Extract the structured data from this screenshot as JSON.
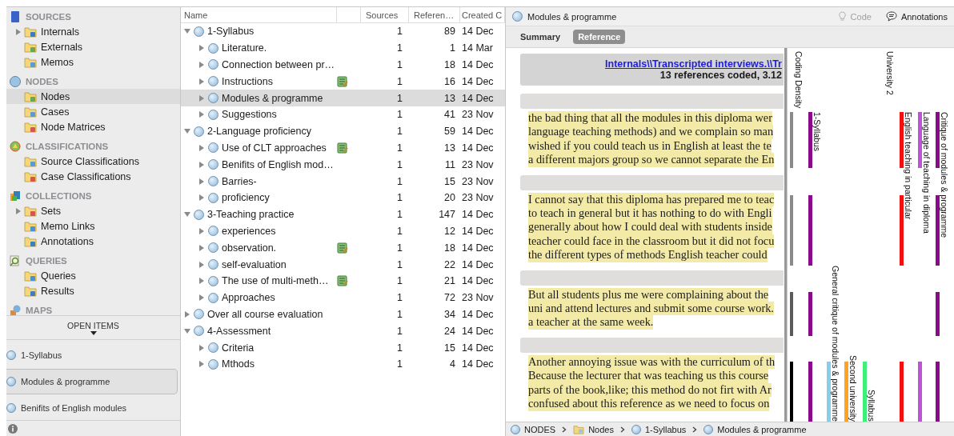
{
  "sidebar": {
    "sections": [
      {
        "title": "SOURCES",
        "items": [
          {
            "label": "Internals",
            "has_children": true,
            "selected": false
          },
          {
            "label": "Externals",
            "has_children": false,
            "selected": false
          },
          {
            "label": "Memos",
            "has_children": false,
            "selected": false
          }
        ]
      },
      {
        "title": "NODES",
        "items": [
          {
            "label": "Nodes",
            "has_children": false,
            "selected": true
          },
          {
            "label": "Cases",
            "has_children": false,
            "selected": false
          },
          {
            "label": "Node Matrices",
            "has_children": false,
            "selected": false
          }
        ]
      },
      {
        "title": "CLASSIFICATIONS",
        "items": [
          {
            "label": "Source Classifications",
            "has_children": false,
            "selected": false
          },
          {
            "label": "Case Classifications",
            "has_children": false,
            "selected": false
          }
        ]
      },
      {
        "title": "COLLECTIONS",
        "items": [
          {
            "label": "Sets",
            "has_children": true,
            "selected": false
          },
          {
            "label": "Memo Links",
            "has_children": false,
            "selected": false
          },
          {
            "label": "Annotations",
            "has_children": false,
            "selected": false
          }
        ]
      },
      {
        "title": "QUERIES",
        "items": [
          {
            "label": "Queries",
            "has_children": false,
            "selected": false
          },
          {
            "label": "Results",
            "has_children": false,
            "selected": false
          }
        ]
      },
      {
        "title": "MAPS"
      }
    ]
  },
  "open_items": {
    "title": "OPEN ITEMS",
    "items": [
      {
        "label": "1-Syllabus",
        "selected": false
      },
      {
        "label": "Modules & programme",
        "selected": true
      },
      {
        "label": "Benifits of English modules",
        "selected": false
      }
    ]
  },
  "tree": {
    "columns": [
      "Name",
      "Sources",
      "Referen…",
      "Created C"
    ],
    "rows": [
      {
        "name": "1-Syllabus",
        "expanded": true,
        "selected": false,
        "memo": false,
        "sources": "1",
        "references": "89",
        "created": "14 Dec",
        "children": [
          {
            "name": "Literature.",
            "expanded": false,
            "selected": false,
            "memo": false,
            "sources": "1",
            "references": "1",
            "created": "14 Mar"
          },
          {
            "name": "Connection between pr…",
            "expanded": false,
            "selected": false,
            "memo": false,
            "sources": "1",
            "references": "18",
            "created": "14 Dec"
          },
          {
            "name": "Instructions",
            "expanded": false,
            "selected": false,
            "memo": true,
            "sources": "1",
            "references": "16",
            "created": "14 Dec"
          },
          {
            "name": "Modules & programme",
            "expanded": false,
            "selected": true,
            "memo": false,
            "sources": "1",
            "references": "13",
            "created": "14 Dec"
          },
          {
            "name": "Suggestions",
            "expanded": false,
            "selected": false,
            "memo": false,
            "sources": "1",
            "references": "41",
            "created": "23 Nov"
          }
        ]
      },
      {
        "name": "2-Language proficiency",
        "expanded": true,
        "selected": false,
        "memo": false,
        "sources": "1",
        "references": "59",
        "created": "14 Dec",
        "children": [
          {
            "name": "Use of CLT approaches",
            "expanded": false,
            "selected": false,
            "memo": true,
            "sources": "1",
            "references": "13",
            "created": "14 Dec"
          },
          {
            "name": "Benifits of English mod…",
            "expanded": false,
            "selected": false,
            "memo": false,
            "sources": "1",
            "references": "11",
            "created": "23 Nov"
          },
          {
            "name": "Barries-",
            "expanded": false,
            "selected": false,
            "memo": false,
            "sources": "1",
            "references": "15",
            "created": "23 Nov"
          },
          {
            "name": "proficiency",
            "expanded": false,
            "selected": false,
            "memo": false,
            "sources": "1",
            "references": "20",
            "created": "23 Nov"
          }
        ]
      },
      {
        "name": "3-Teaching practice",
        "expanded": true,
        "selected": false,
        "memo": false,
        "sources": "1",
        "references": "147",
        "created": "14 Dec",
        "children": [
          {
            "name": "experiences",
            "expanded": false,
            "selected": false,
            "memo": false,
            "sources": "1",
            "references": "12",
            "created": "14 Dec"
          },
          {
            "name": "observation.",
            "expanded": false,
            "selected": false,
            "memo": true,
            "sources": "1",
            "references": "18",
            "created": "14 Dec"
          },
          {
            "name": "self-evaluation",
            "expanded": false,
            "selected": false,
            "memo": false,
            "sources": "1",
            "references": "22",
            "created": "14 Dec"
          },
          {
            "name": "The use of multi-meth…",
            "expanded": false,
            "selected": false,
            "memo": true,
            "sources": "1",
            "references": "21",
            "created": "14 Dec"
          },
          {
            "name": "Approaches",
            "expanded": false,
            "selected": false,
            "memo": false,
            "sources": "1",
            "references": "72",
            "created": "23 Nov"
          }
        ]
      },
      {
        "name": "Over all course evaluation",
        "expanded": false,
        "selected": false,
        "memo": false,
        "sources": "1",
        "references": "34",
        "created": "14 Dec"
      },
      {
        "name": "4-Assessment",
        "expanded": true,
        "selected": false,
        "memo": false,
        "sources": "1",
        "references": "24",
        "created": "14 Dec",
        "children": [
          {
            "name": "Criteria",
            "expanded": false,
            "selected": false,
            "memo": false,
            "sources": "1",
            "references": "15",
            "created": "14 Dec"
          },
          {
            "name": "Mthods",
            "expanded": false,
            "selected": false,
            "memo": false,
            "sources": "1",
            "references": "4",
            "created": "14 Dec"
          }
        ]
      }
    ]
  },
  "detail": {
    "title": "Modules & programme",
    "code": {
      "label": "Code",
      "disabled": true
    },
    "annotations": "Annotations",
    "tabs": [
      {
        "label": "Summary",
        "selected": false
      },
      {
        "label": "Reference",
        "selected": true
      }
    ],
    "source_link": "Internals\\\\Transcripted interviews.\\\\Tr",
    "coverage": "13 references coded, 3.12",
    "references": [
      {
        "lines": [
          "the bad thing that all the modules in this diploma wer",
          "language teaching methods) and we complain so man",
          "wished if you could teach us in English at least the te",
          "a different majors group so we cannot separate the En"
        ]
      },
      {
        "lines": [
          "I cannot say that this diploma has prepared me to teac",
          "to teach in general but it has nothing to do with Engli",
          "generally about how I could deal with students inside",
          "teacher could face in the classroom but it did not focu",
          "the different types of methods English teacher could"
        ]
      },
      {
        "lines": [
          "But all students plus me were complaining about the",
          "uni and attend lectures and submit some course work.",
          "a teacher at the same week."
        ]
      },
      {
        "lines": [
          "Another annoying issue was with the curriculum of th",
          "Because the lecturer that was teaching us this course",
          "parts of the book,like; this method do not firt with Ar",
          "confused about this reference as we need to focus on"
        ]
      }
    ],
    "coding_density": {
      "label": "Coding Density",
      "segments": [
        {
          "color": "#8a8a8a"
        },
        {
          "color": "#8a8a8a"
        },
        {
          "color": "#5a5a5a"
        },
        {
          "color": "#000000"
        }
      ]
    },
    "stripes": [
      {
        "label": "1-Syllabus",
        "color": "#8b0a8b",
        "refs": [
          true,
          true,
          true,
          true
        ]
      },
      {
        "label": "General critique of modules & programme",
        "color": "#87ceeb",
        "refs": [
          false,
          false,
          false,
          true
        ]
      },
      {
        "label": "Second university",
        "color": "#ffa420",
        "refs": [
          false,
          false,
          false,
          true
        ]
      },
      {
        "label": "Syllabus",
        "color": "#3ef07a",
        "refs": [
          false,
          false,
          false,
          true
        ]
      },
      {
        "label": "University 2",
        "refs": [
          false,
          false,
          false,
          false
        ]
      },
      {
        "label": "English teaching in particular",
        "color": "#f01010",
        "refs": [
          true,
          true,
          false,
          true
        ]
      },
      {
        "label": "Language of teaching in diploma",
        "color": "#bb55d3",
        "refs": [
          true,
          false,
          false,
          true
        ]
      },
      {
        "label": "Critique of modules & programme",
        "color": "#8b0a8b",
        "refs": [
          true,
          true,
          true,
          true
        ]
      }
    ],
    "breadcrumb": [
      "NODES",
      "Nodes",
      "1-Syllabus",
      "Modules & programme"
    ]
  }
}
